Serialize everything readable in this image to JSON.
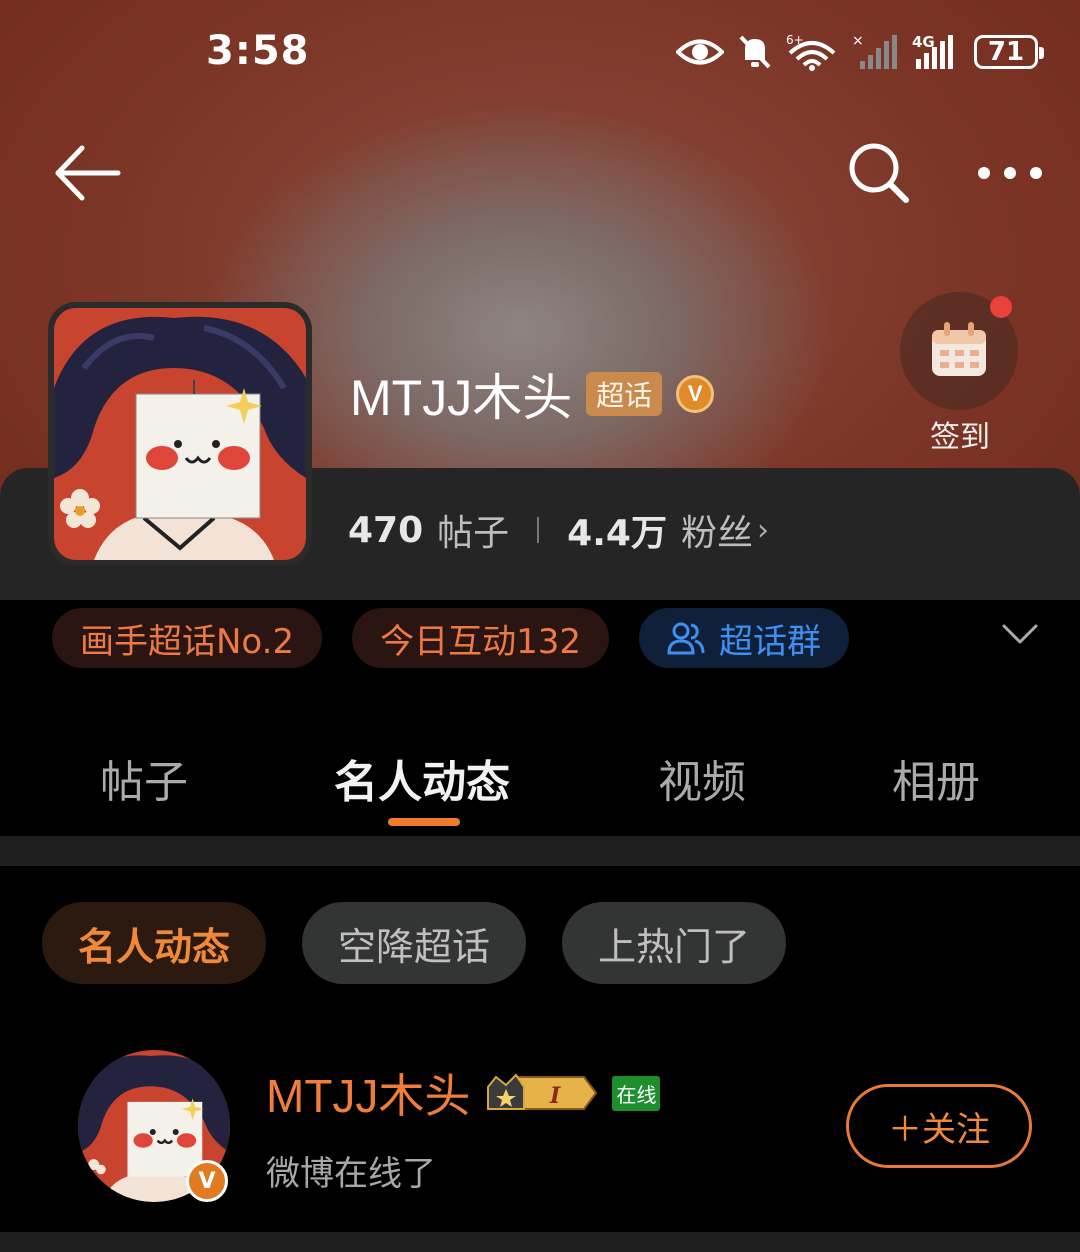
{
  "status_bar": {
    "time": "3:58",
    "battery": "71"
  },
  "profile": {
    "name": "MTJJ木头",
    "chaohua_tag": "超话",
    "verified_letter": "V",
    "checkin_label": "签到",
    "posts_count": "470",
    "posts_label": "帖子",
    "fans_count": "4.4万",
    "fans_label": "粉丝",
    "fans_arrow": "›"
  },
  "chips": [
    {
      "label": "画手超话No.2"
    },
    {
      "label": "今日互动132"
    },
    {
      "label": "超话群"
    }
  ],
  "tabs": [
    {
      "label": "帖子"
    },
    {
      "label": "名人动态"
    },
    {
      "label": "视频"
    },
    {
      "label": "相册"
    }
  ],
  "active_tab": "名人动态",
  "filters": [
    {
      "label": "名人动态"
    },
    {
      "label": "空降超话"
    },
    {
      "label": "上热门了"
    }
  ],
  "post": {
    "author": "MTJJ木头",
    "level": "I",
    "online_tag": "在线",
    "verified_letter": "V",
    "text": "微博在线了",
    "follow_label": "＋关注"
  },
  "colors": {
    "accent": "#f07a2a",
    "blue": "#3e8ff0",
    "online": "#1f8f2e"
  }
}
